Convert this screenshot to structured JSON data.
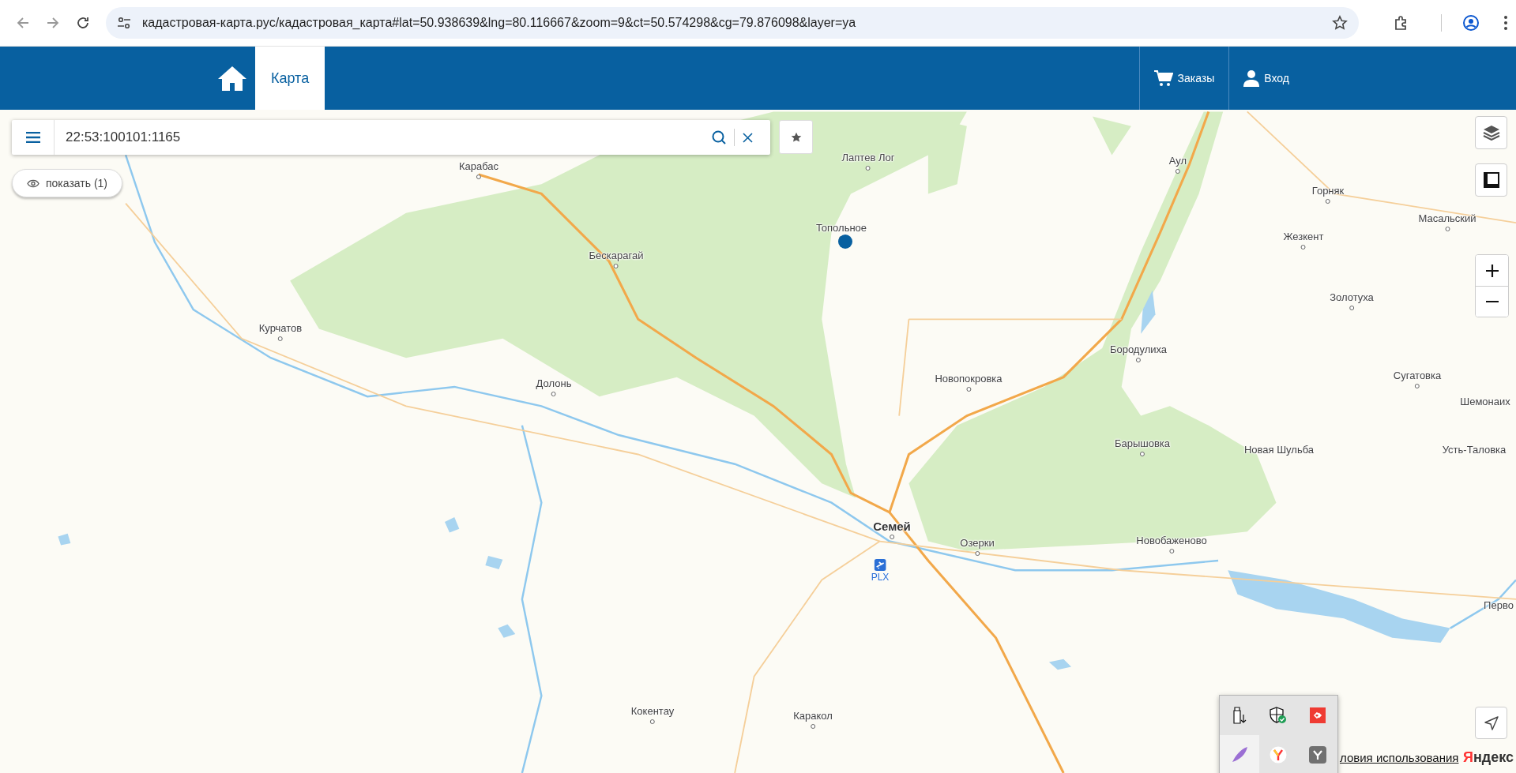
{
  "browser": {
    "url": "кадастровая-карта.рус/кадастровая_карта#lat=50.938639&lng=80.116667&zoom=9&ct=50.574298&cg=79.876098&layer=ya"
  },
  "header": {
    "tabs": [
      {
        "label": "Карта",
        "selected": true
      }
    ],
    "actions": [
      {
        "label": "Заказы",
        "kind": "cart"
      },
      {
        "label": "Вход",
        "kind": "user"
      }
    ]
  },
  "search": {
    "value": "22:53:100101:1165"
  },
  "show_button": {
    "label": "показать (1)"
  },
  "map": {
    "places": [
      {
        "name": "Карабас",
        "kind": "village"
      },
      {
        "name": "Лаптев Лог",
        "kind": "village"
      },
      {
        "name": "Аул",
        "kind": "village"
      },
      {
        "name": "Горняк",
        "kind": "village"
      },
      {
        "name": "Масальский",
        "kind": "village"
      },
      {
        "name": "Топольное",
        "kind": "village"
      },
      {
        "name": "Жезкент",
        "kind": "village"
      },
      {
        "name": "Бескарагай",
        "kind": "village"
      },
      {
        "name": "Золотуха",
        "kind": "village"
      },
      {
        "name": "Курчатов",
        "kind": "village"
      },
      {
        "name": "Бородулиха",
        "kind": "village"
      },
      {
        "name": "Новопокровка",
        "kind": "village"
      },
      {
        "name": "Сугатовка",
        "kind": "village"
      },
      {
        "name": "Долонь",
        "kind": "village"
      },
      {
        "name": "Шемонаих",
        "kind": "label"
      },
      {
        "name": "Барышовка",
        "kind": "village"
      },
      {
        "name": "Новая Шульба",
        "kind": "label"
      },
      {
        "name": "Усть-Таловка",
        "kind": "label"
      },
      {
        "name": "Семей",
        "kind": "city"
      },
      {
        "name": "Озерки",
        "kind": "village"
      },
      {
        "name": "Новобаженово",
        "kind": "village"
      },
      {
        "name": "PLX",
        "kind": "airport"
      },
      {
        "name": "Перво",
        "kind": "label"
      },
      {
        "name": "Кокентау",
        "kind": "village"
      },
      {
        "name": "Каракол",
        "kind": "village"
      }
    ]
  },
  "footer": {
    "terms_link": "ловия использования",
    "logo": "Яндекс"
  }
}
